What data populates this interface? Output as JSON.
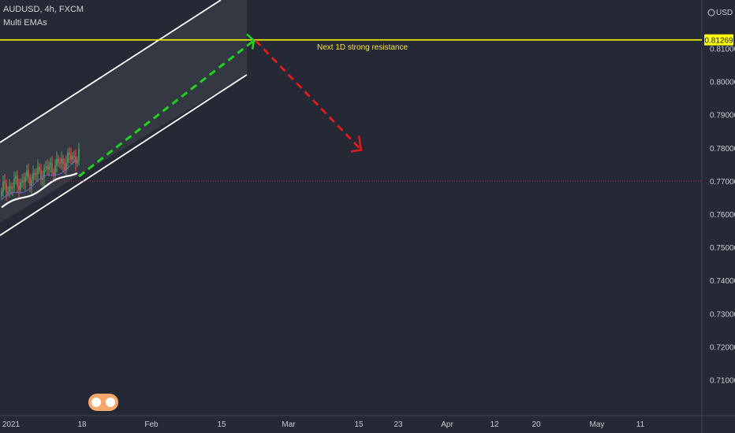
{
  "header": {
    "symbol": "AUDUSD, 4h, FXCM",
    "indicator": "Multi EMAs"
  },
  "currency": "USD",
  "annotation": "Next 1D strong resistance",
  "colors": {
    "background": "#252935",
    "resistance": "#ffff00",
    "up_arrow": "#22d11e",
    "down_arrow": "#e21b1b",
    "channel_line": "#ffffff",
    "channel_fill": "#353a45",
    "current_price_line": "#a8344a"
  },
  "chart_data": {
    "type": "line",
    "price_axis": {
      "ticks": [
        "0.81000",
        "0.80000",
        "0.79000",
        "0.78000",
        "0.77000",
        "0.76000",
        "0.75000",
        "0.74000",
        "0.73000",
        "0.72000",
        "0.71000"
      ],
      "tick_values": [
        0.81,
        0.8,
        0.79,
        0.78,
        0.77,
        0.76,
        0.75,
        0.74,
        0.73,
        0.72,
        0.71
      ],
      "ylim": [
        0.7015,
        0.8185
      ]
    },
    "time_axis": {
      "labels": [
        "2021",
        "18",
        "Feb",
        "15",
        "Mar",
        "15",
        "23",
        "Apr",
        "12",
        "20",
        "May",
        "11"
      ]
    },
    "resistance_level": {
      "value": 0.81269,
      "label": "0.81269"
    },
    "current_price": 0.7701,
    "channel": {
      "upper": [
        [
          0,
          0.7806
        ],
        [
          40,
          0.785
        ],
        [
          80,
          0.7895
        ],
        [
          120,
          0.794
        ],
        [
          160,
          0.7984
        ],
        [
          200,
          0.803
        ],
        [
          240,
          0.8074
        ],
        [
          280,
          0.8118
        ]
      ],
      "lower": [
        [
          0,
          0.758
        ],
        [
          40,
          0.7625
        ],
        [
          80,
          0.7668
        ],
        [
          120,
          0.7712
        ],
        [
          160,
          0.7757
        ],
        [
          200,
          0.7801
        ],
        [
          240,
          0.7846
        ],
        [
          290,
          0.7902
        ]
      ]
    },
    "projection_up": {
      "from": [
        0.7715
      ],
      "to": [
        0.8125
      ]
    },
    "projection_down": {
      "from": [
        0.8125
      ],
      "to": [
        0.7795
      ]
    }
  }
}
